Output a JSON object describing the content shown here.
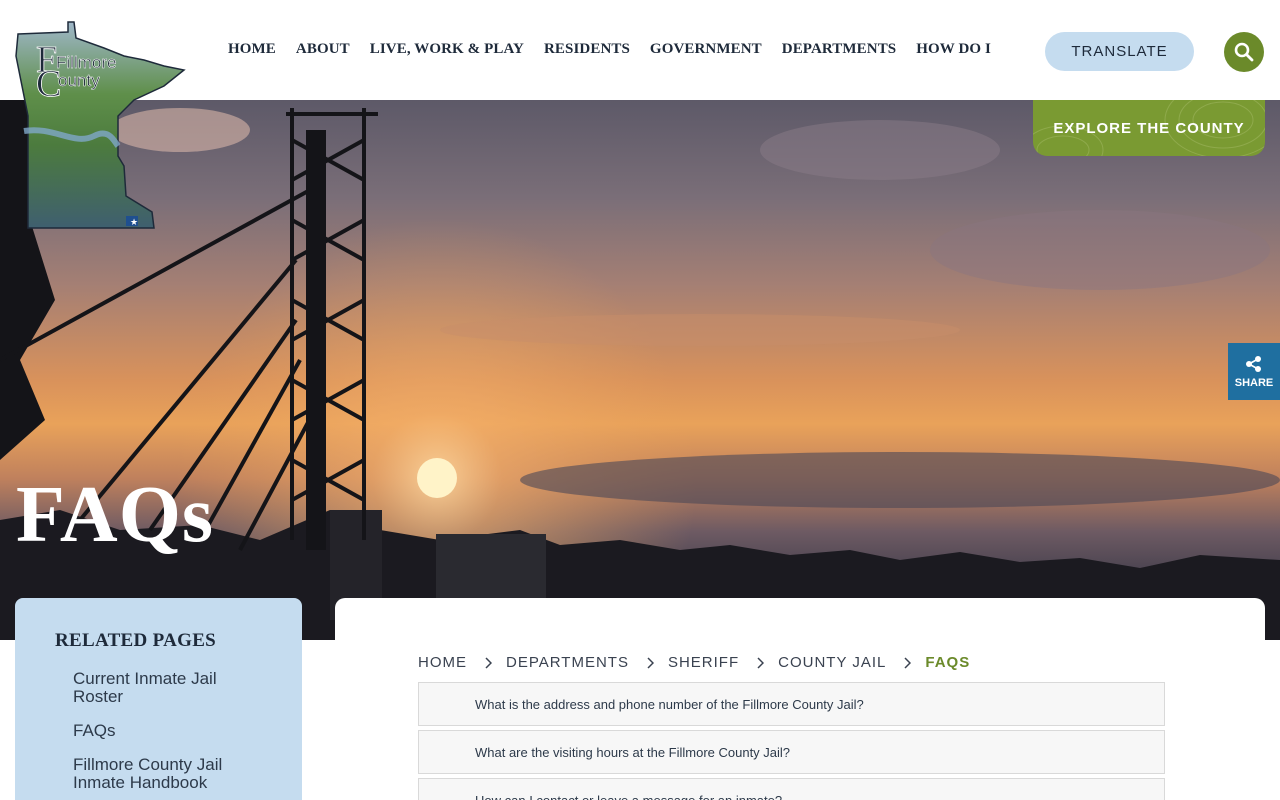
{
  "header": {
    "logo_text_line1": "Fillmore",
    "logo_text_line2": "County",
    "nav": [
      "HOME",
      "ABOUT",
      "LIVE, WORK & PLAY",
      "RESIDENTS",
      "GOVERNMENT",
      "DEPARTMENTS",
      "HOW DO I"
    ],
    "translate_label": "TRANSLATE",
    "search_icon": "search-icon"
  },
  "hero": {
    "explore_label": "EXPLORE THE COUNTY",
    "share_label": "SHARE",
    "page_title": "FAQs"
  },
  "sidebar": {
    "heading": "RELATED PAGES",
    "items": [
      "Current Inmate Jail Roster",
      "FAQs",
      "Fillmore County Jail Inmate Handbook"
    ]
  },
  "breadcrumb": [
    "HOME",
    "DEPARTMENTS",
    "SHERIFF",
    "COUNTY JAIL",
    "FAQS"
  ],
  "faqs": [
    "What is the address and phone number of the Fillmore County Jail?",
    "What are the visiting hours at the Fillmore County Jail?",
    "How can I contact or leave a message for an inmate?"
  ],
  "colors": {
    "accent_green": "#6b8a2a",
    "light_blue": "#c5dcef",
    "share_blue": "#1f6fa0",
    "navy_text": "#1e2a3a"
  }
}
